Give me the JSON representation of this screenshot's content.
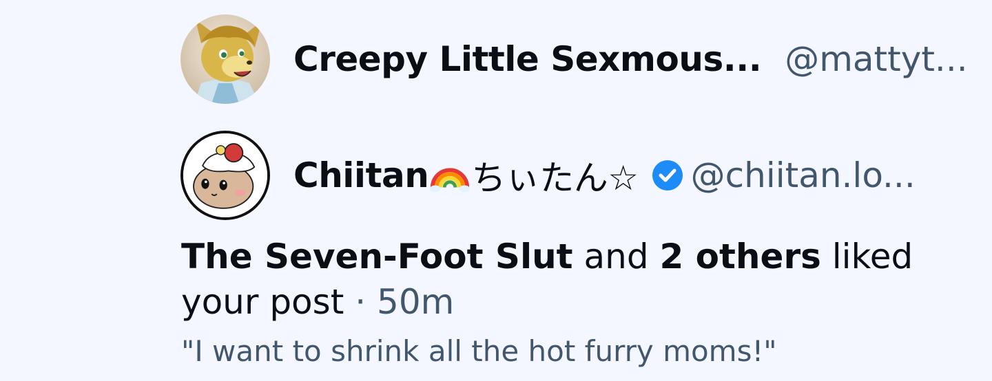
{
  "users": [
    {
      "display_name": "Creepy Little Sexmous...",
      "handle": "@mattyt...",
      "avatar_icon": "fox-avatar-icon",
      "verified": false
    },
    {
      "display_name_prefix": "Chiitan",
      "display_name_suffix": "ちぃたん☆",
      "emoji_icon": "rainbow-emoji-icon",
      "handle": "@chiitan.lo...",
      "avatar_icon": "chiitan-avatar-icon",
      "verified": true,
      "verified_color": "#1d8cf8"
    }
  ],
  "notification": {
    "actor": "The Seven-Foot Slut",
    "conjunction": "and",
    "others": "2 others",
    "action": "liked your post",
    "separator": "·",
    "time": "50m"
  },
  "post_quote": "\"I want to shrink all the hot furry moms!\"",
  "colors": {
    "background": "#f4f7ff",
    "text": "#0b0f14",
    "secondary_text": "#42576c",
    "verified": "#1d8cf8"
  }
}
